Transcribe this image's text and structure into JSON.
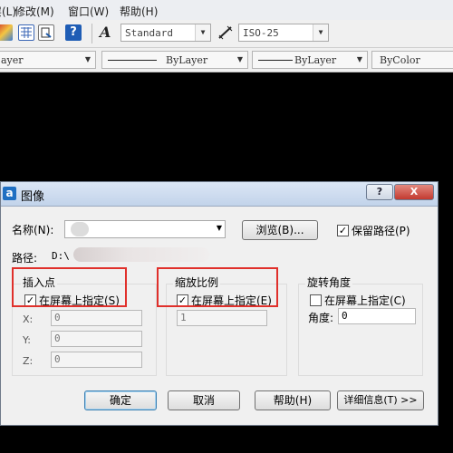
{
  "menu": {
    "items": [
      "层(L)",
      "修改(M)",
      "窗口(W)",
      "帮助(H)"
    ]
  },
  "toolbar": {
    "text_style": "Standard",
    "dim_style": "ISO-25"
  },
  "properties_bar": {
    "layer": "ayer",
    "linetype": "ByLayer",
    "lineweight": "ByLayer",
    "color": "ByColor"
  },
  "dialog": {
    "title": "图像",
    "app_icon": "a",
    "title_help": "?",
    "title_close": "X",
    "name_label": "名称(N):",
    "name_value": "",
    "browse_label": "浏览(B)...",
    "keep_path_label": "保留路径(P)",
    "keep_path_checked": true,
    "path_label": "路径:",
    "path_value": "D:\\",
    "insertion": {
      "title": "插入点",
      "specify_label": "在屏幕上指定(S)",
      "specify_checked": true,
      "x_label": "X:",
      "x_value": "0",
      "y_label": "Y:",
      "y_value": "0",
      "z_label": "Z:",
      "z_value": "0"
    },
    "scale": {
      "title": "缩放比例",
      "specify_label": "在屏幕上指定(E)",
      "specify_checked": true,
      "value": "1"
    },
    "rotation": {
      "title": "旋转角度",
      "specify_label": "在屏幕上指定(C)",
      "specify_checked": false,
      "angle_label": "角度:",
      "angle_value": "0"
    },
    "buttons": {
      "ok": "确定",
      "cancel": "取消",
      "help": "帮助(H)",
      "details": "详细信息(T) >>"
    }
  },
  "colors": {
    "highlight": "#e0302b",
    "title_gradient_top": "#dbe6f5",
    "close_button": "#c9463d"
  },
  "icons": [
    "paint-icon",
    "table-icon",
    "layer-icon",
    "help-icon",
    "text-style-icon",
    "dim-style-icon"
  ]
}
